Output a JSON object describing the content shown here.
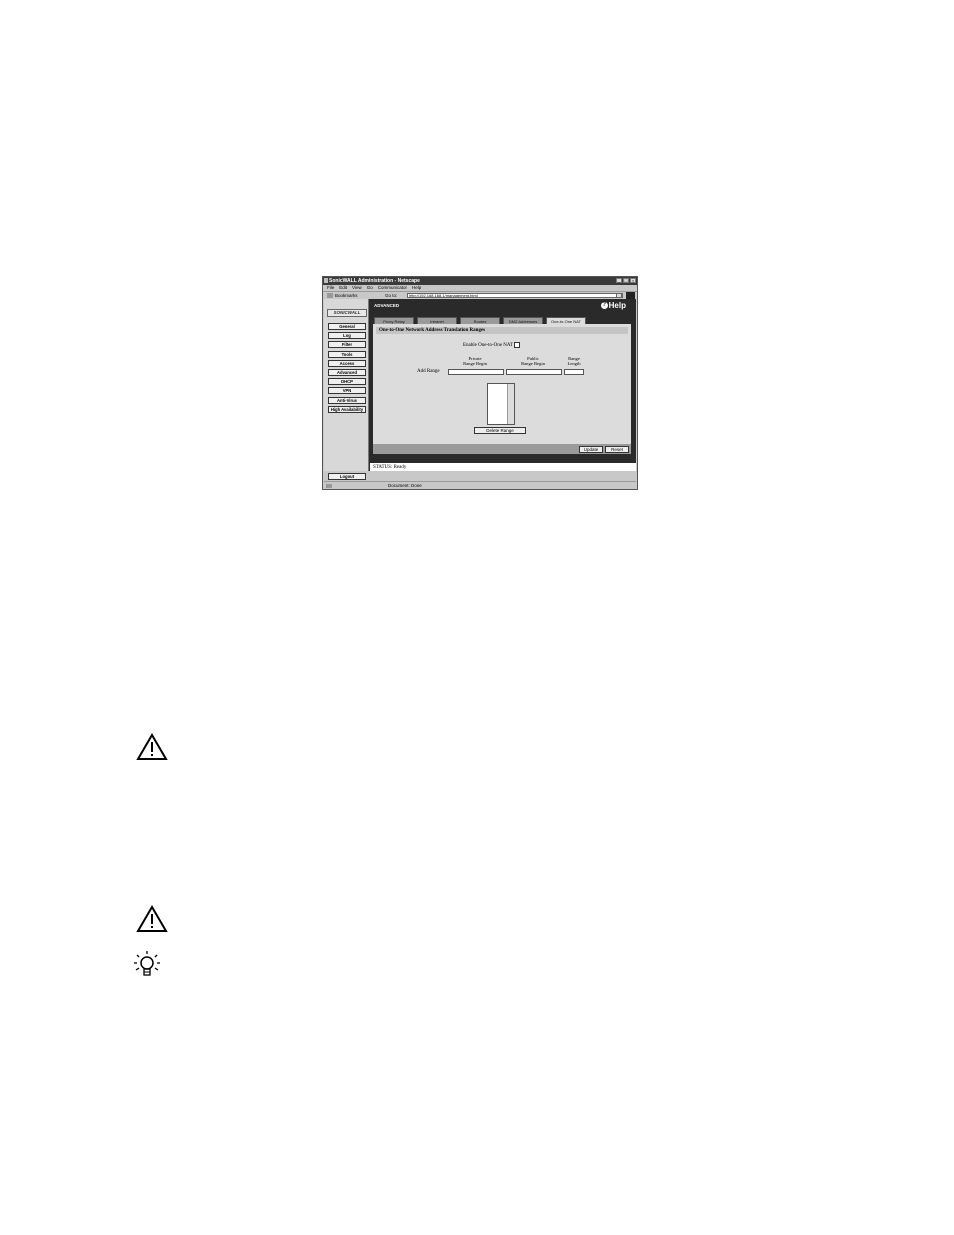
{
  "window": {
    "title": "SonicWALL Administration - Netscape",
    "menu": [
      "File",
      "Edit",
      "View",
      "Go",
      "Communicator",
      "Help"
    ],
    "bookmarks_label": "Bookmarks",
    "goto_label": "Go to:",
    "url": "http://192.168.168.1/management.html",
    "status_doc": "Document: Done"
  },
  "sidebar": {
    "logo": "SONICWALL",
    "items": [
      "General",
      "Log",
      "Filter",
      "Tools",
      "Access",
      "Advanced",
      "DHCP",
      "VPN",
      "Anti-Virus",
      "High Availability"
    ],
    "logout": "Logout"
  },
  "main": {
    "section": "ADVANCED",
    "help": "Help",
    "tabs": [
      "Proxy Relay",
      "Intranet",
      "Routes",
      "DMZ Addresses",
      "One-to-One NAT"
    ],
    "active_tab": "One-to-One NAT",
    "panel_title": "One-to-One Network Address Translation Ranges",
    "enable_label": "Enable One-to-One NAT",
    "enable_checked": false,
    "col_private": "Private\nRange Begin",
    "col_public": "Public\nRange Begin",
    "col_length": "Range\nLength",
    "add_range_label": "Add Range",
    "delete_range": "Delete Range",
    "update": "Update",
    "reset": "Reset",
    "status": "STATUS: Ready"
  },
  "margin_icons": [
    "warning-icon",
    "warning-icon",
    "tip-icon"
  ]
}
